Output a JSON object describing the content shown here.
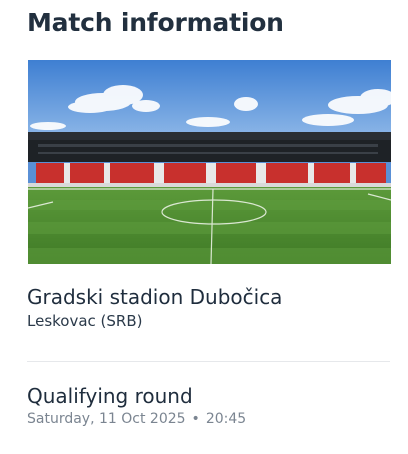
{
  "section_title": "Match information",
  "image": {
    "alt": "Gradski stadion Dubočica"
  },
  "venue": {
    "name": "Gradski stadion Dubočica",
    "city": "Leskovac (SRB)"
  },
  "match": {
    "round": "Qualifying round",
    "date": "Saturday, 11 Oct 2025",
    "separator": "•",
    "time": "20:45"
  },
  "colors": {
    "heading": "#22303f",
    "muted": "#7b8591",
    "pitch": "#4f8a2f",
    "seats": "#d0302e",
    "sky": "#4a86d4"
  }
}
